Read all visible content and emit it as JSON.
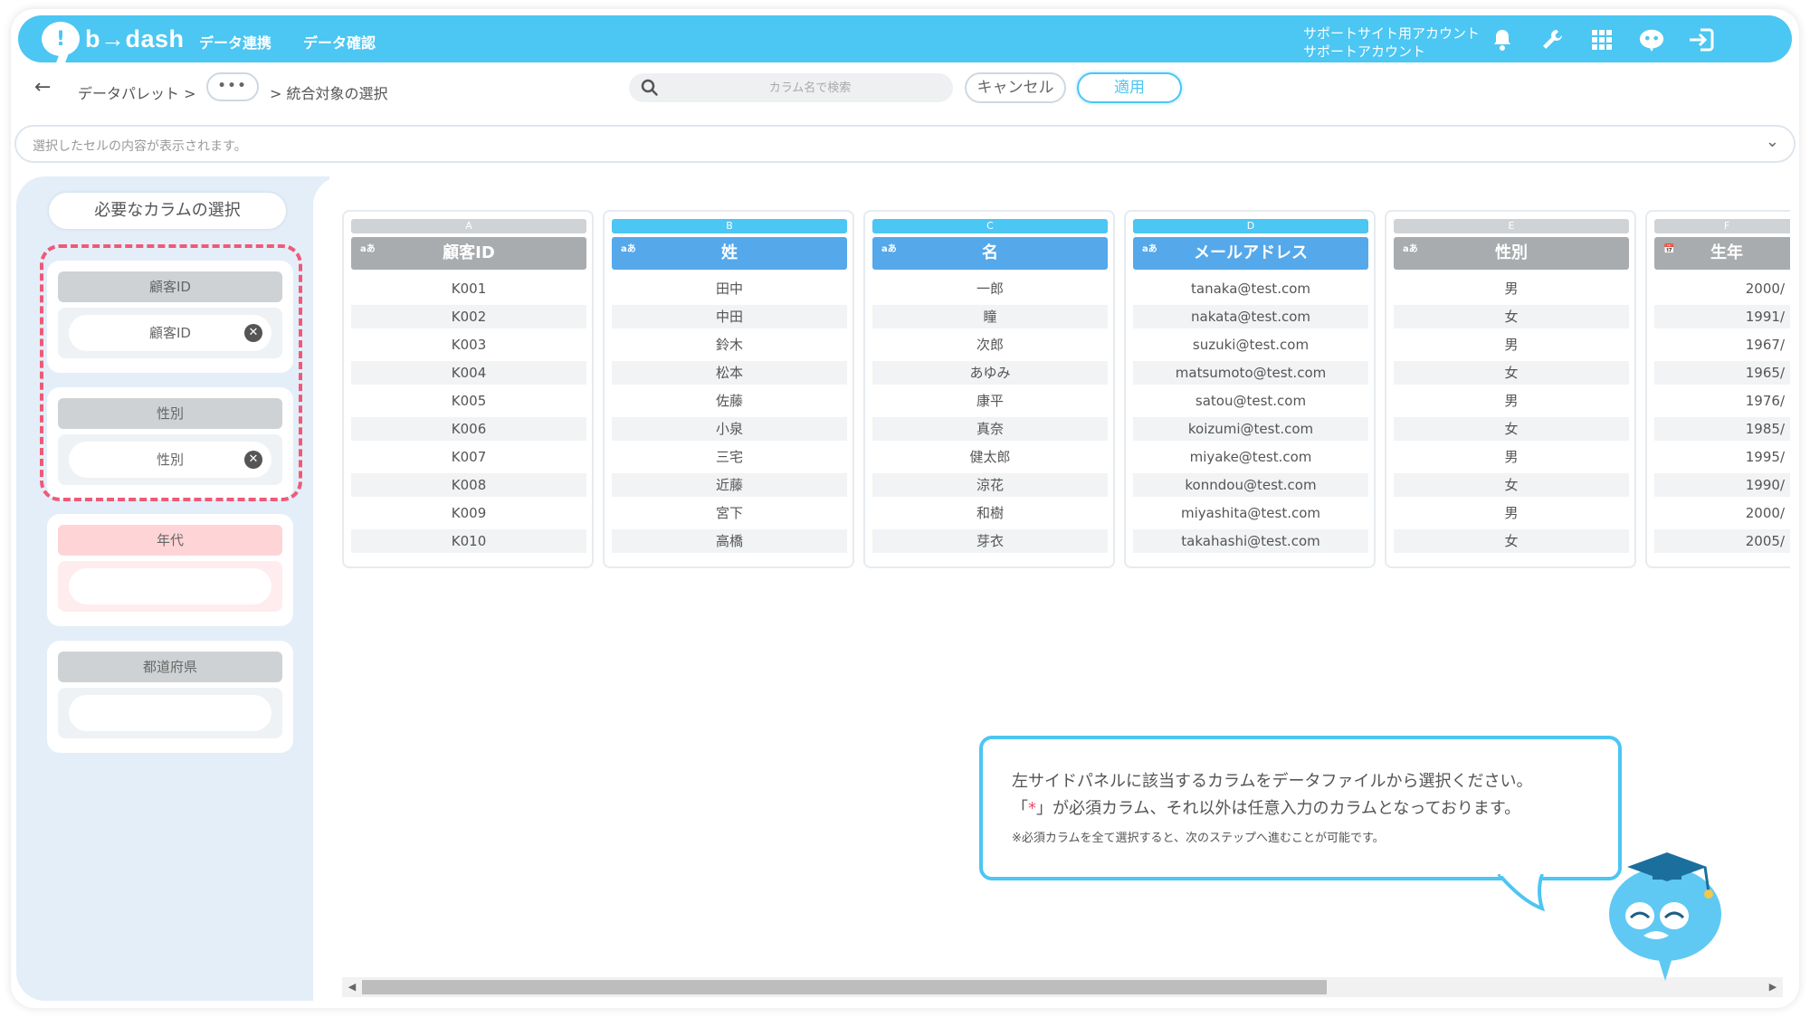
{
  "nav": {
    "logo_text": "b→dash",
    "links": [
      "データ連携",
      "データ確認"
    ],
    "account_line1": "サポートサイト用アカウント",
    "account_line2": "サポートアカウント",
    "icons": [
      "bell-icon",
      "wrench-icon",
      "grid-icon",
      "mascot-icon",
      "logout-icon"
    ],
    "accent_color": "#4cc6f2"
  },
  "toolbar": {
    "back_symbol": "←",
    "crumb_root": "データパレット >",
    "more": "•••",
    "crumb_current": "> 統合対象の選択",
    "search_placeholder": "カラム名で検索",
    "cancel_label": "キャンセル",
    "apply_label": "適用"
  },
  "cellbar": {
    "placeholder": "選択したセルの内容が表示されます。",
    "chevron": "⌄"
  },
  "left_panel": {
    "title": "必要なカラムの選択",
    "slots": [
      {
        "label": "顧客ID",
        "value": "顧客ID",
        "state": "filled"
      },
      {
        "label": "性別",
        "value": "性別",
        "state": "filled"
      },
      {
        "label": "年代",
        "value": "",
        "state": "required-empty"
      },
      {
        "label": "都道府県",
        "value": "",
        "state": "empty"
      }
    ]
  },
  "columns": [
    {
      "letter": "A",
      "type": "aあ",
      "name": "顧客ID",
      "selected": false,
      "values": [
        "K001",
        "K002",
        "K003",
        "K004",
        "K005",
        "K006",
        "K007",
        "K008",
        "K009",
        "K010"
      ]
    },
    {
      "letter": "B",
      "type": "aあ",
      "name": "姓",
      "selected": true,
      "values": [
        "田中",
        "中田",
        "鈴木",
        "松本",
        "佐藤",
        "小泉",
        "三宅",
        "近藤",
        "宮下",
        "高橋"
      ]
    },
    {
      "letter": "C",
      "type": "aあ",
      "name": "名",
      "selected": true,
      "values": [
        "一郎",
        "瞳",
        "次郎",
        "あゆみ",
        "康平",
        "真奈",
        "健太郎",
        "涼花",
        "和樹",
        "芽衣"
      ]
    },
    {
      "letter": "D",
      "type": "aあ",
      "name": "メールアドレス",
      "selected": true,
      "values": [
        "tanaka@test.com",
        "nakata@test.com",
        "suzuki@test.com",
        "matsumoto@test.com",
        "satou@test.com",
        "koizumi@test.com",
        "miyake@test.com",
        "konndou@test.com",
        "miyashita@test.com",
        "takahashi@test.com"
      ]
    },
    {
      "letter": "E",
      "type": "aあ",
      "name": "性別",
      "selected": false,
      "values": [
        "男",
        "女",
        "男",
        "女",
        "男",
        "女",
        "男",
        "女",
        "男",
        "女"
      ]
    },
    {
      "letter": "F",
      "type": "📅",
      "name": "生年",
      "selected": false,
      "values": [
        "2000/",
        "1991/",
        "1967/",
        "1965/",
        "1976/",
        "1985/",
        "1995/",
        "1990/",
        "2000/",
        "2005/"
      ]
    }
  ],
  "hint": {
    "line1": "左サイドパネルに該当するカラムをデータファイルから選択ください。",
    "line2_pre": "「",
    "line2_star": "*",
    "line2_post": "」が必須カラム、それ以外は任意入力のカラムとなっております。",
    "line3": "※必須カラムを全て選択すると、次のステップへ進むことが可能です。"
  }
}
